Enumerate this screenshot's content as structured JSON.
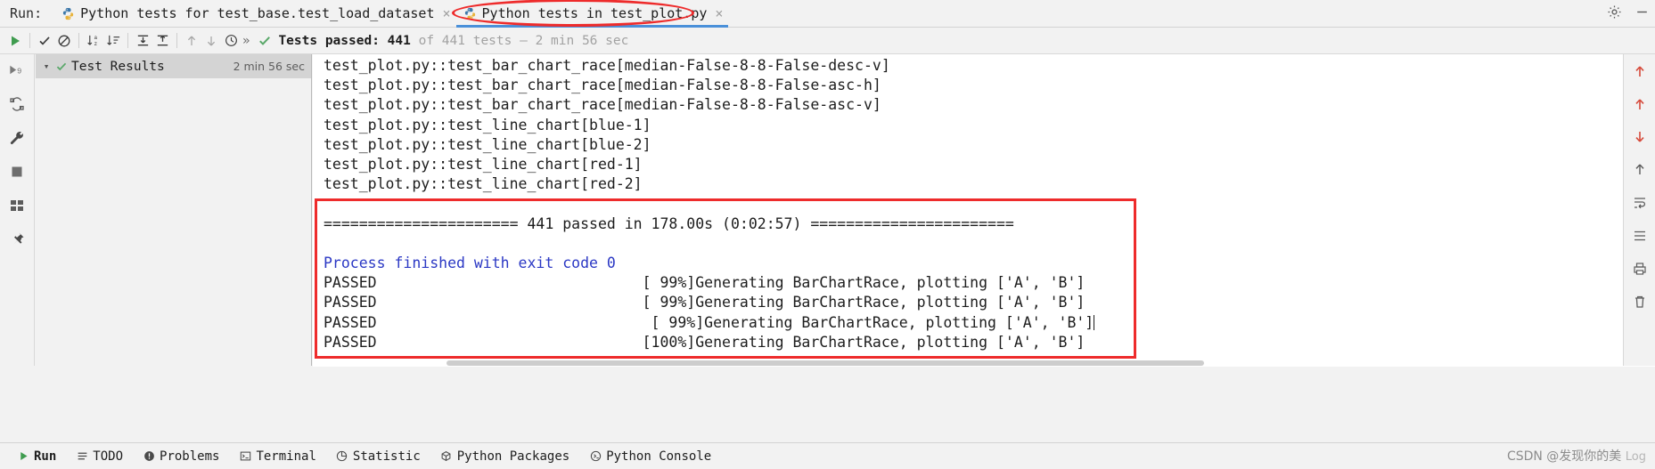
{
  "window": {
    "run_label": "Run:",
    "settings_icon": "gear-icon",
    "minimize_icon": "minimize-icon"
  },
  "tabs": [
    {
      "label": "Python tests for test_base.test_load_dataset",
      "icon": "python-test-icon",
      "close": "×",
      "active": false
    },
    {
      "label": "Python tests in test_plot.py",
      "icon": "python-test-icon",
      "close": "×",
      "active": true
    }
  ],
  "toolbar": {
    "icons": [
      "run-icon",
      "show-passed-icon",
      "hide-ignored-icon",
      "sort-alphabetically-icon",
      "sort-by-duration-icon",
      "expand-all-icon",
      "collapse-all-icon",
      "previous-failed-icon",
      "next-failed-icon",
      "history-icon"
    ],
    "overflow_label": "»",
    "status_check": "check-icon",
    "status_passed_label": "Tests passed:",
    "status_passed_count": "441",
    "status_of_total": "of 441 tests",
    "status_dash": "–",
    "status_duration": "2 min 56 sec"
  },
  "left_rail": {
    "icons": [
      "rerun-icon",
      "rerun-failed-icon",
      "wrench-settings-icon",
      "stop-icon",
      "layout-icon",
      "pin-icon"
    ]
  },
  "test_tree": {
    "expand_arrow": "chevron-down-icon",
    "status_icon": "check-icon",
    "root_label": "Test Results",
    "root_duration": "2 min 56 sec"
  },
  "console": {
    "lines": [
      {
        "text": "test_plot.py::test_bar_chart_race[median-False-8-8-False-desc-v]",
        "style": "plain"
      },
      {
        "text": "test_plot.py::test_bar_chart_race[median-False-8-8-False-asc-h]",
        "style": "plain"
      },
      {
        "text": "test_plot.py::test_bar_chart_race[median-False-8-8-False-asc-v]",
        "style": "plain"
      },
      {
        "text": "test_plot.py::test_line_chart[blue-1]",
        "style": "plain"
      },
      {
        "text": "test_plot.py::test_line_chart[blue-2]",
        "style": "plain"
      },
      {
        "text": "test_plot.py::test_line_chart[red-1]",
        "style": "plain"
      },
      {
        "text": "test_plot.py::test_line_chart[red-2]",
        "style": "plain"
      },
      {
        "text": "",
        "style": "plain"
      },
      {
        "text": "====================== 441 passed in 178.00s (0:02:57) =======================",
        "style": "plain"
      },
      {
        "text": "",
        "style": "plain"
      },
      {
        "text": "Process finished with exit code 0",
        "style": "blue"
      },
      {
        "text": "PASSED                              [ 99%]Generating BarChartRace, plotting ['A', 'B']",
        "style": "plain"
      },
      {
        "text": "PASSED                              [ 99%]Generating BarChartRace, plotting ['A', 'B']",
        "style": "plain"
      },
      {
        "text": "PASSED                               [ 99%]Generating BarChartRace, plotting ['A', 'B']",
        "style": "plain",
        "caret": true
      },
      {
        "text": "PASSED                              [100%]Generating BarChartRace, plotting ['A', 'B']",
        "style": "plain"
      }
    ]
  },
  "right_rail": {
    "icons": [
      "scroll-to-top-icon",
      "up-arrow-icon",
      "down-arrow-icon",
      "scroll-to-end-icon",
      "soft-wrap-icon",
      "list-icon",
      "print-icon",
      "trash-icon"
    ]
  },
  "status_bar": {
    "items": [
      {
        "label": "Run",
        "icon": "run-icon",
        "selected": true
      },
      {
        "label": "TODO",
        "icon": "todo-icon",
        "selected": false
      },
      {
        "label": "Problems",
        "icon": "problems-icon",
        "selected": false
      },
      {
        "label": "Terminal",
        "icon": "terminal-icon",
        "selected": false
      },
      {
        "label": "Statistic",
        "icon": "statistic-icon",
        "selected": false
      },
      {
        "label": "Python Packages",
        "icon": "packages-icon",
        "selected": false
      },
      {
        "label": "Python Console",
        "icon": "console-icon",
        "selected": false
      }
    ],
    "watermark": "CSDN @发现你的美",
    "watermark_sub": "Log"
  },
  "colors": {
    "accent": "#4a90d9",
    "annotation_red": "#ee2b2b",
    "pass_green": "#59a869",
    "link_blue": "#2b38c4"
  }
}
